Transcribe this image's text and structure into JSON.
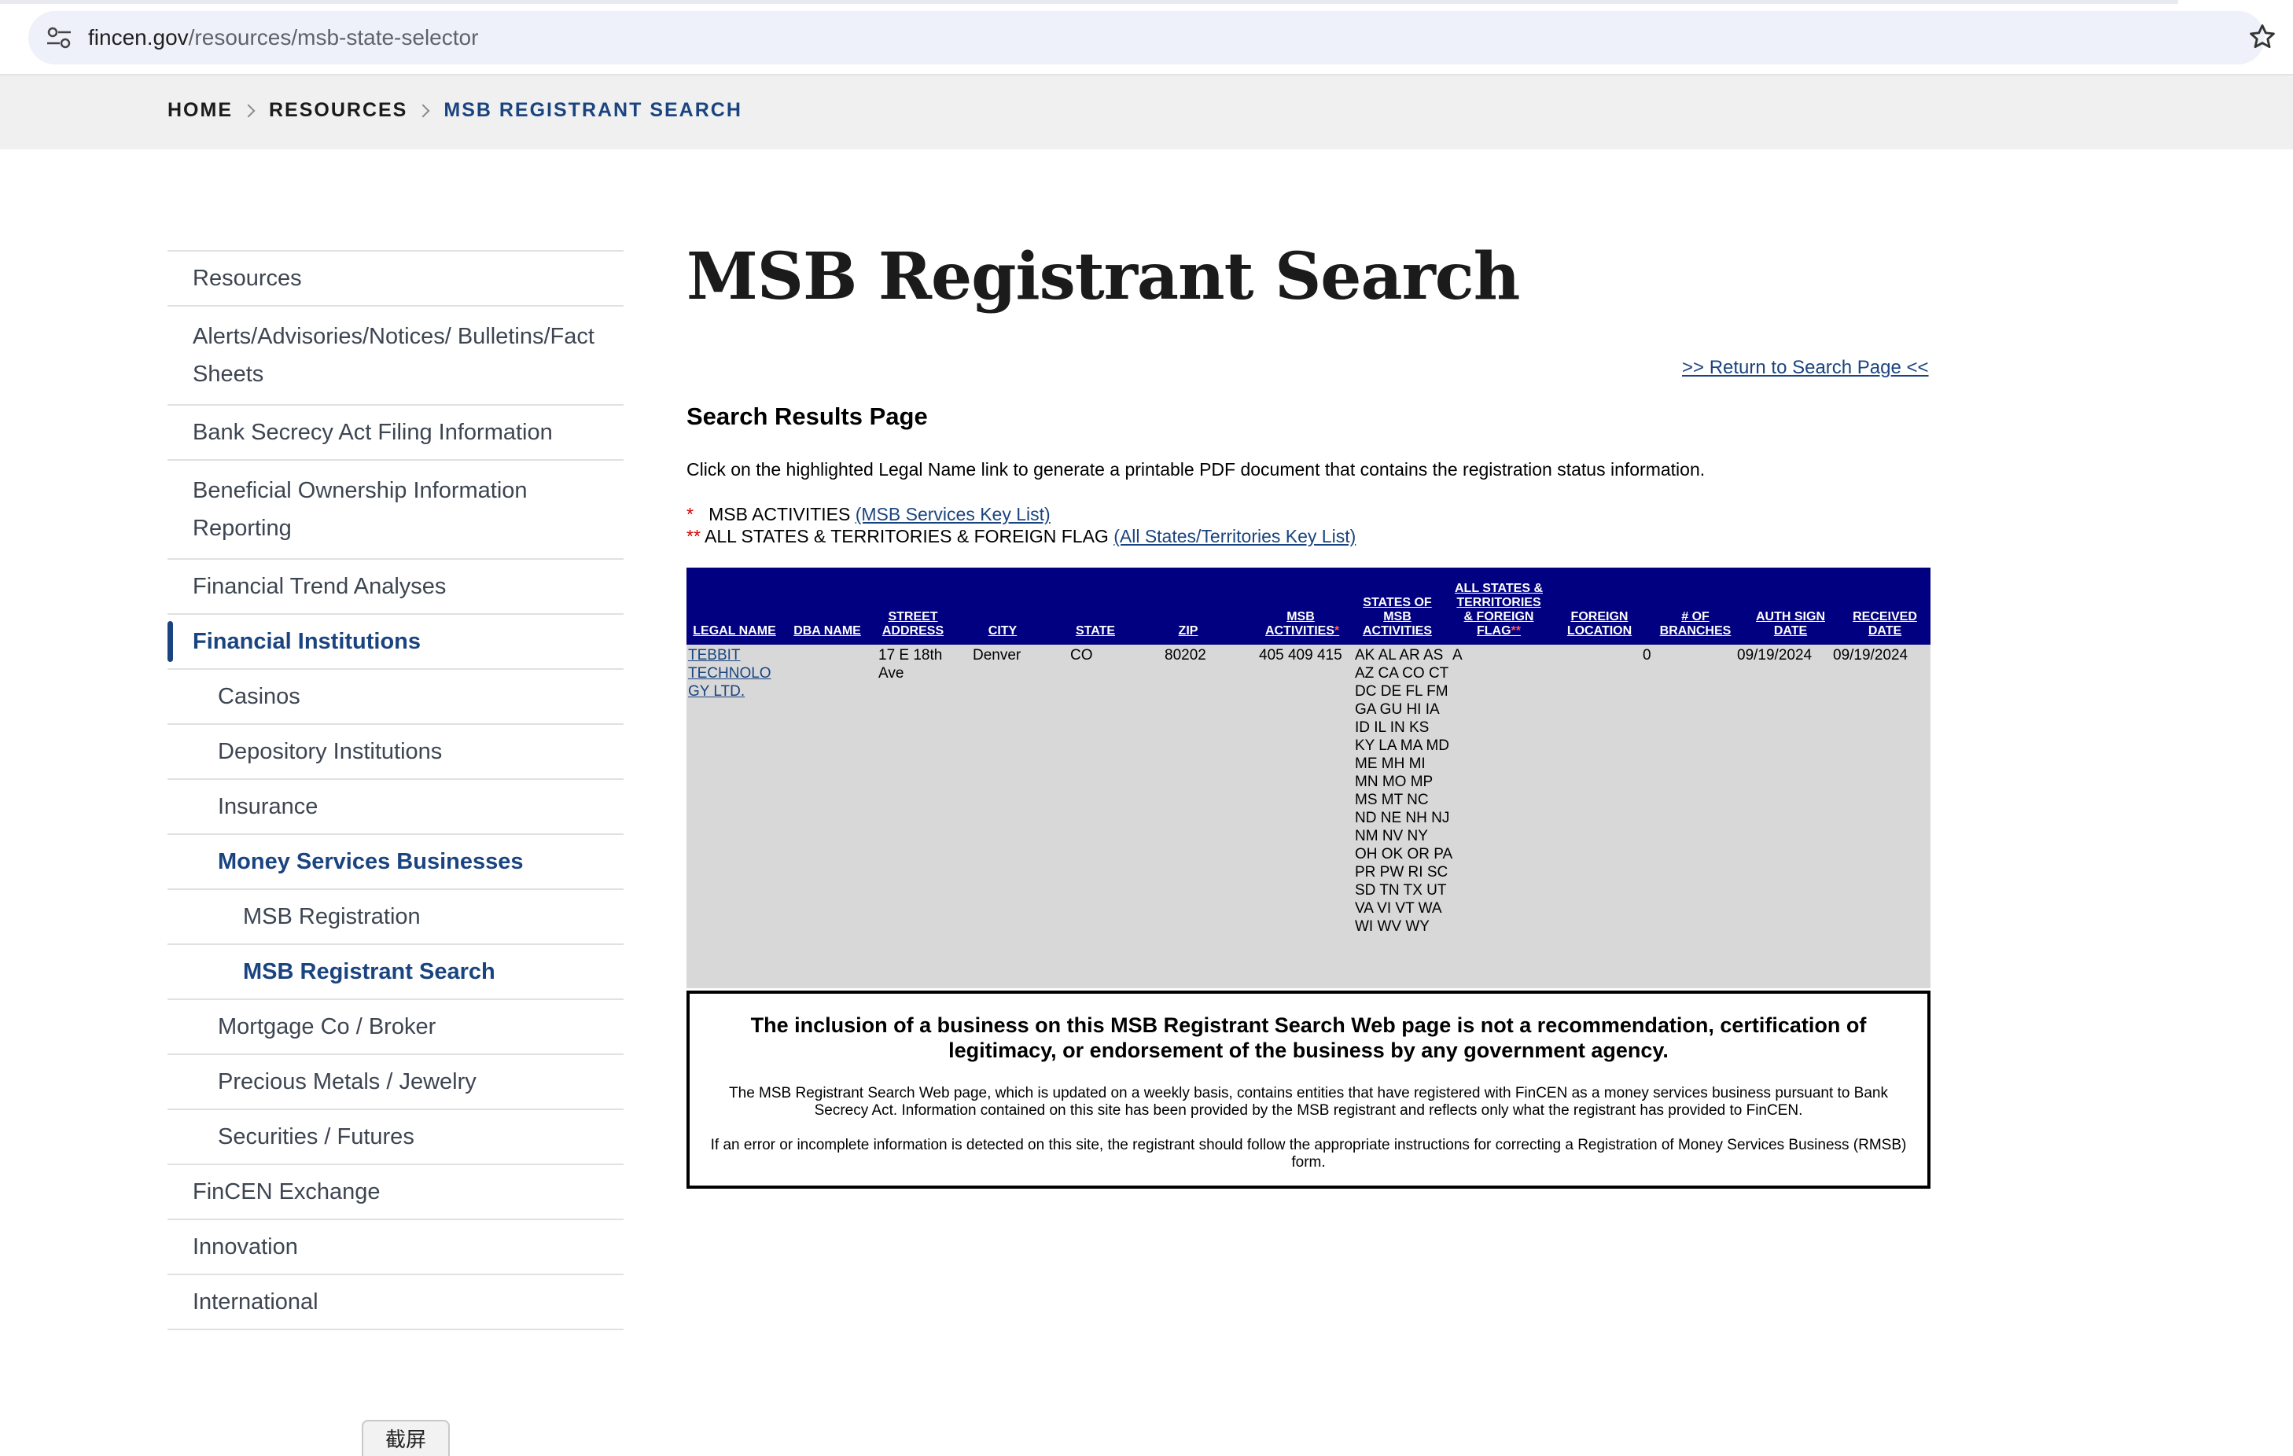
{
  "browser": {
    "url_host": "fincen.gov",
    "url_path": "/resources/msb-state-selector"
  },
  "breadcrumb": [
    "HOME",
    "RESOURCES",
    "MSB REGISTRANT SEARCH"
  ],
  "sidebar": {
    "items": [
      {
        "label": "Resources",
        "level": 1
      },
      {
        "label": "Alerts/Advisories/Notices/ Bulletins/Fact Sheets",
        "level": 1
      },
      {
        "label": "Bank Secrecy Act Filing Information",
        "level": 1
      },
      {
        "label": "Beneficial Ownership Information Reporting",
        "level": 1
      },
      {
        "label": "Financial Trend Analyses",
        "level": 1
      },
      {
        "label": "Financial Institutions",
        "level": 1,
        "active": true
      },
      {
        "label": "Casinos",
        "level": 2
      },
      {
        "label": "Depository Institutions",
        "level": 2
      },
      {
        "label": "Insurance",
        "level": 2
      },
      {
        "label": "Money Services Businesses",
        "level": 2,
        "active": true
      },
      {
        "label": "MSB Registration",
        "level": 3
      },
      {
        "label": "MSB Registrant Search",
        "level": 3,
        "active": true
      },
      {
        "label": "Mortgage Co / Broker",
        "level": 2
      },
      {
        "label": "Precious Metals / Jewelry",
        "level": 2
      },
      {
        "label": "Securities / Futures",
        "level": 2
      },
      {
        "label": "FinCEN Exchange",
        "level": 1
      },
      {
        "label": "Innovation",
        "level": 1
      },
      {
        "label": "International",
        "level": 1
      }
    ]
  },
  "main": {
    "title": "MSB Registrant Search",
    "return_link": ">> Return to Search Page <<",
    "results_heading": "Search Results Page",
    "instructions": "Click on the highlighted Legal Name link to generate a printable PDF document that contains the registration status information.",
    "legend": {
      "msb_marker": "*",
      "msb_text": "MSB ACTIVITIES",
      "msb_link": "(MSB Services Key List)",
      "states_marker": "**",
      "states_text": "ALL STATES & TERRITORIES & FOREIGN FLAG",
      "states_link": "(All States/Territories Key List)"
    }
  },
  "table": {
    "headers": {
      "legal_name": "LEGAL NAME",
      "dba_name": "DBA NAME",
      "street": "STREET ADDRESS",
      "city": "CITY",
      "state": "STATE",
      "zip": "ZIP",
      "msb_activities": "MSB ACTIVITIES",
      "states_of_msb": "STATES OF MSB ACTIVITIES",
      "all_states": "ALL STATES & TERRITORIES & FOREIGN FLAG",
      "foreign_location": "FOREIGN LOCATION",
      "branches": "# OF BRANCHES",
      "auth_date": "AUTH SIGN DATE",
      "received_date": "RECEIVED DATE",
      "star1": "*",
      "star2": "**"
    },
    "row": {
      "legal_name": "TEBBIT TECHNOLO GY LTD.",
      "dba_name": "",
      "street": "17 E 18th Ave",
      "city": "Denver",
      "state": "CO",
      "zip": "80202",
      "msb_activities": "405 409 415",
      "states": "AK AL AR AS AZ CA CO CT DC DE FL FM GA GU HI IA ID IL IN KS KY LA MA MD ME MH MI MN MO MP MS MT NC ND NE NH NJ NM NV NY OH OK OR PA PR PW RI SC SD TN TX UT VA VI VT WA WI WV WY",
      "all_states": "A",
      "foreign_location": "",
      "branches": "0",
      "auth_date": "09/19/2024",
      "received_date": "09/19/2024"
    }
  },
  "disclaimer": {
    "main": "The inclusion of a business on this MSB Registrant Search Web page is not a recommendation, certification of legitimacy, or endorsement of the business by any government agency.",
    "p1": "The MSB Registrant Search Web page, which is updated on a weekly basis, contains entities that have registered with FinCEN as a money services business pursuant to Bank Secrecy Act. Information contained on this site has been provided by the MSB registrant and reflects only what the registrant has provided to FinCEN.",
    "p2": "If an error or incomplete information is detected on this site, the registrant should follow the appropriate instructions for correcting a Registration of Money Services Business (RMSB) form."
  },
  "overlay": {
    "capture_label": "截屏"
  }
}
